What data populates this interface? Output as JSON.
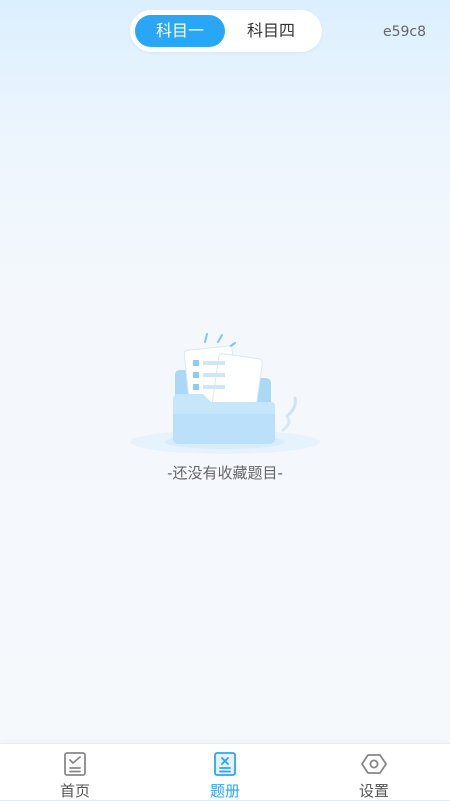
{
  "subject_switch": {
    "tabs": [
      {
        "label": "科目一",
        "active": true
      },
      {
        "label": "科目四",
        "active": false
      }
    ],
    "accent_color": "#2aa6f6"
  },
  "top_right_code": "e59c8",
  "empty_state": {
    "icon": "empty-folder-icon",
    "message": "-还没有收藏题目-"
  },
  "tabbar": {
    "items": [
      {
        "label": "首页",
        "icon": "checklist-icon",
        "active": false
      },
      {
        "label": "题册",
        "icon": "wrong-book-icon",
        "active": true
      },
      {
        "label": "设置",
        "icon": "settings-icon",
        "active": false
      }
    ],
    "active_color": "#2aa6f6",
    "inactive_color": "#555555"
  }
}
